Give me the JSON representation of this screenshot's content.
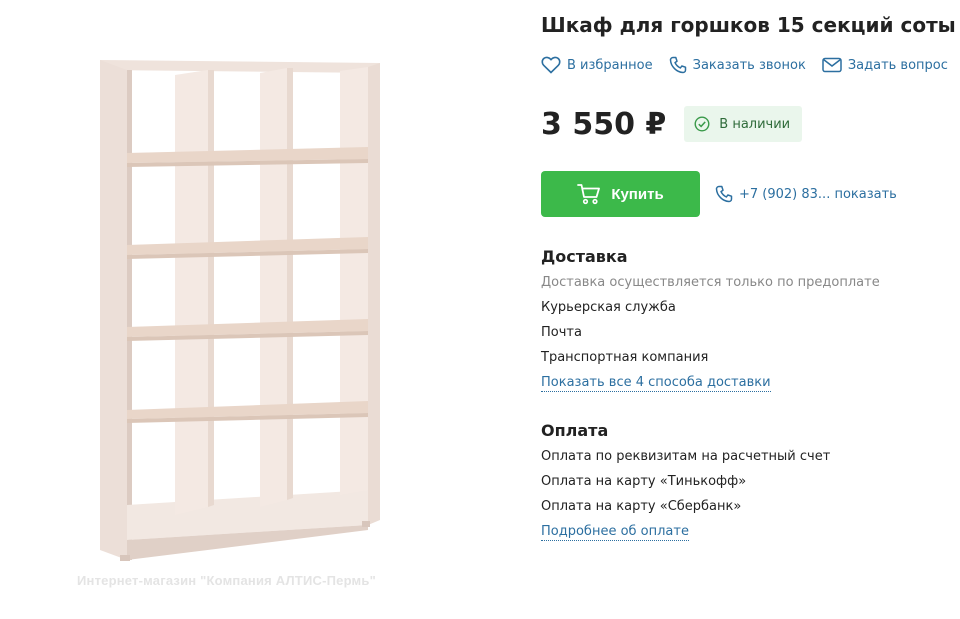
{
  "product": {
    "title": "Шкаф для горшков 15 секций соты",
    "image_alt": "Шкаф для горшков 15 секций",
    "watermark": "Интернет-магазин \"Компания АЛТИС-Пермь\""
  },
  "actions": {
    "favorite": "В избранное",
    "callback": "Заказать звонок",
    "question": "Задать вопрос"
  },
  "price": {
    "amount": "3 550 ₽",
    "availability": "В наличии"
  },
  "buy": {
    "button_label": "Купить",
    "phone": "+7 (902) 83... показать"
  },
  "delivery": {
    "title": "Доставка",
    "note": "Доставка осуществляется только по предоплате",
    "methods": [
      "Курьерская служба",
      "Почта",
      "Транспортная компания"
    ],
    "more_link": "Показать все 4 способа доставки"
  },
  "payment": {
    "title": "Оплата",
    "methods": [
      "Оплата по реквизитам на расчетный счет",
      "Оплата на карту «Тинькофф»",
      "Оплата на карту «Сбербанк»"
    ],
    "more_link": "Подробнее об оплате"
  },
  "colors": {
    "link": "#2c6fa0",
    "buy_green": "#3cb94a",
    "stock_bg": "#eaf6ec"
  }
}
